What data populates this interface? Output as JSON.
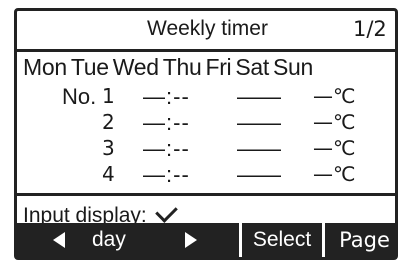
{
  "header": {
    "title": "Weekly timer",
    "page": "1/2"
  },
  "days": [
    "Mon",
    "Tue",
    "Wed",
    "Thu",
    "Fri",
    "Sat",
    "Sun"
  ],
  "rows": [
    {
      "label": "No.",
      "num": "1",
      "time": "—:--",
      "setting": "——",
      "temp": "—℃"
    },
    {
      "label": "",
      "num": "2",
      "time": "—:--",
      "setting": "——",
      "temp": "—℃"
    },
    {
      "label": "",
      "num": "3",
      "time": "—:--",
      "setting": "——",
      "temp": "—℃"
    },
    {
      "label": "",
      "num": "4",
      "time": "—:--",
      "setting": "——",
      "temp": "—℃"
    }
  ],
  "input_display": {
    "label": "Input display:",
    "icon": "check-icon"
  },
  "buttons": {
    "day": "day",
    "select": "Select",
    "page": "Page"
  },
  "colors": {
    "foreground": "#222222",
    "background": "#ffffff"
  }
}
